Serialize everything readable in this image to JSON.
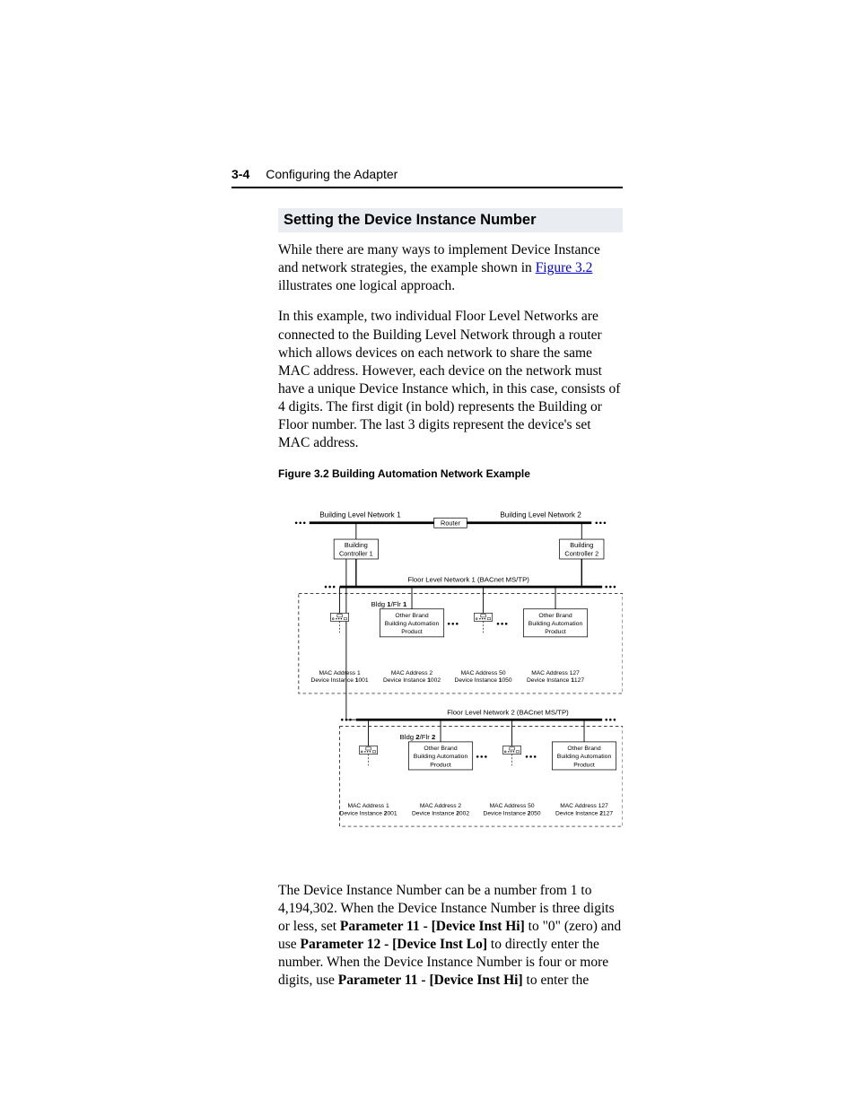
{
  "header": {
    "page_number": "3-4",
    "chapter_title": "Configuring the Adapter"
  },
  "section": {
    "title": "Setting the Device Instance Number",
    "para1_a": "While there are many ways to implement Device Instance and network strategies, the example shown in ",
    "para1_link": "Figure 3.2",
    "para1_b": " illustrates one logical approach.",
    "para2": "In this example, two individual Floor Level Networks are connected to the Building Level Network through a router which allows devices on each network to share the same MAC address. However, each device on the network must have a unique Device Instance which, in this case, consists of 4 digits. The first digit (in bold) represents the Building or Floor number. The last 3 digits represent the device's set MAC address.",
    "figure_caption": "Figure 3.2   Building Automation Network Example",
    "para3": {
      "seg1": "The Device Instance Number can be a number from 1 to 4,194,302. When the Device Instance Number is three digits or less, set ",
      "bold1": "Parameter 11 - [Device Inst Hi]",
      "seg2": " to \"0\" (zero) and use ",
      "bold2": "Parameter 12 - [Device Inst Lo]",
      "seg3": " to directly enter the number. When the Device Instance Number is four or more digits, use ",
      "bold3": "Parameter 11 - [Device Inst Hi]",
      "seg4": " to enter the"
    }
  },
  "diagram": {
    "bln1": "Building Level Network 1",
    "bln2": "Building Level Network 2",
    "router": "Router",
    "bc1_l1": "Building",
    "bc1_l2": "Controller 1",
    "bc2_l1": "Building",
    "bc2_l2": "Controller 2",
    "fln1": "Floor Level Network 1 (BACnet MS/TP)",
    "fln2": "Floor Level Network 2 (BACnet MS/TP)",
    "bf1_a": "Bldg ",
    "bf1_b": "/Flr ",
    "bf1_n": "1",
    "bf2_a": "Bldg ",
    "bf2_b": "/Flr ",
    "bf2_n": "2",
    "other_l1": "Other Brand",
    "other_l2": "Building Automation",
    "other_l3": "Product",
    "n1": {
      "dev1_mac": "MAC Address 1",
      "dev1_di_a": "Device Instance ",
      "dev1_di_b": "1",
      "dev1_di_c": "001",
      "dev2_mac": "MAC Address 2",
      "dev2_di_a": "Device Instance ",
      "dev2_di_b": "1",
      "dev2_di_c": "002",
      "dev3_mac": "MAC Address 50",
      "dev3_di_a": "Device Instance ",
      "dev3_di_b": "1",
      "dev3_di_c": "050",
      "dev4_mac": "MAC Address 127",
      "dev4_di_a": "Device Instance ",
      "dev4_di_b": "1",
      "dev4_di_c": "127"
    },
    "n2": {
      "dev1_mac": "MAC Address 1",
      "dev1_di_a": "Device Instance ",
      "dev1_di_b": "2",
      "dev1_di_c": "001",
      "dev2_mac": "MAC Address 2",
      "dev2_di_a": "Device Instance ",
      "dev2_di_b": "2",
      "dev2_di_c": "002",
      "dev3_mac": "MAC Address 50",
      "dev3_di_a": "Device Instance ",
      "dev3_di_b": "2",
      "dev3_di_c": "050",
      "dev4_mac": "MAC Address 127",
      "dev4_di_a": "Device Instance ",
      "dev4_di_b": "2",
      "dev4_di_c": "127"
    }
  }
}
